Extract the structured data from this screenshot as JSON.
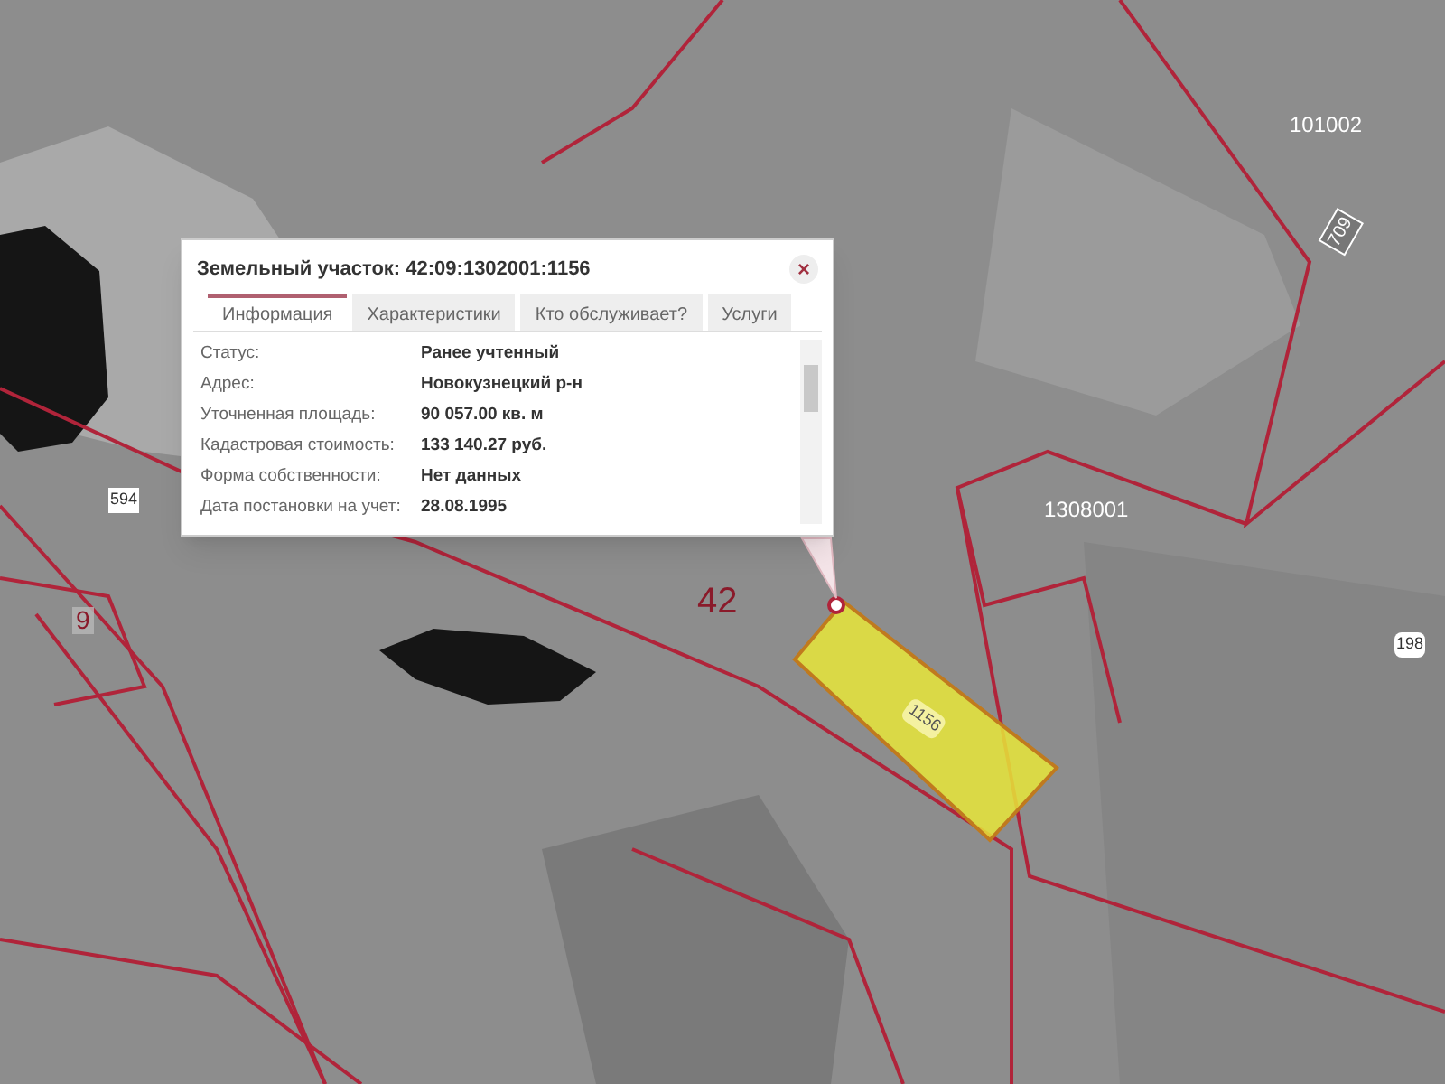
{
  "popup": {
    "title": "Земельный участок: 42:09:1302001:1156",
    "close": "×",
    "tabs": [
      {
        "label": "Информация",
        "selected": true
      },
      {
        "label": "Характеристики",
        "selected": false
      },
      {
        "label": "Кто обслуживает?",
        "selected": false
      },
      {
        "label": "Услуги",
        "selected": false
      }
    ],
    "fields": [
      {
        "label": "Статус:",
        "value": "Ранее учтенный"
      },
      {
        "label": "Адрес:",
        "value": "Новокузнецкий р-н"
      },
      {
        "label": "Уточненная площадь:",
        "value": "90 057.00 кв. м"
      },
      {
        "label": "Кадастровая стоимость:",
        "value": "133 140.27 руб."
      },
      {
        "label": "Форма собственности:",
        "value": "Нет данных"
      },
      {
        "label": "Дата постановки на учет:",
        "value": "28.08.1995"
      }
    ]
  },
  "map": {
    "labels": [
      {
        "text": "101002"
      },
      {
        "text": "709"
      },
      {
        "text": "1308001"
      },
      {
        "text": "42"
      },
      {
        "text": "594"
      },
      {
        "text": "9"
      },
      {
        "text": "198"
      }
    ],
    "selected_parcel": {
      "label": "1156"
    }
  }
}
